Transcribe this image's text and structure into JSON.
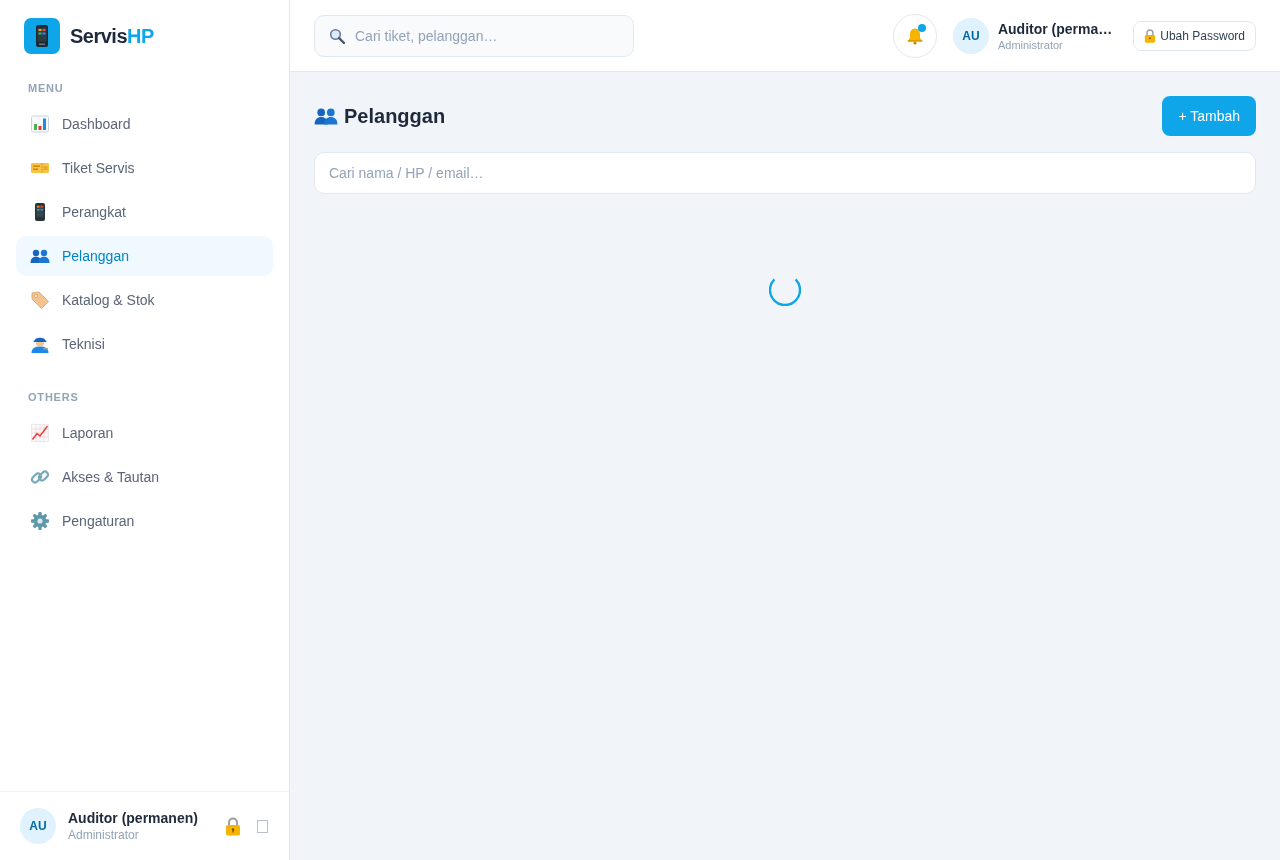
{
  "sidebar": {
    "brand": {
      "name": "Servis",
      "accent": "HP"
    },
    "sections": [
      {
        "heading": "MENU",
        "items": [
          {
            "label": "Dashboard",
            "selected": false
          },
          {
            "label": "Tiket Servis",
            "selected": false
          },
          {
            "label": "Perangkat",
            "selected": false
          },
          {
            "label": "Pelanggan",
            "selected": true
          },
          {
            "label": "Katalog & Stok",
            "selected": false
          },
          {
            "label": "Teknisi",
            "selected": false
          }
        ]
      },
      {
        "heading": "OTHERS",
        "items": [
          {
            "label": "Laporan",
            "selected": false
          },
          {
            "label": "Akses & Tautan",
            "selected": false
          },
          {
            "label": "Pengaturan",
            "selected": false
          }
        ]
      }
    ],
    "user": {
      "initials": "AU",
      "name": "Auditor (permanen)",
      "role": "Administrator"
    }
  },
  "header": {
    "search": {
      "placeholder": "Cari tiket, pelanggan…"
    },
    "notifications": {
      "unread": true
    },
    "user": {
      "initials": "AU",
      "name": "Auditor (perma…",
      "role": "Administrator"
    },
    "password_button": "Ubah Password"
  },
  "page": {
    "title": "Pelanggan",
    "add_button": "+ Tambah",
    "search": {
      "placeholder": "Cari nama / HP / email…"
    },
    "loading": true
  }
}
